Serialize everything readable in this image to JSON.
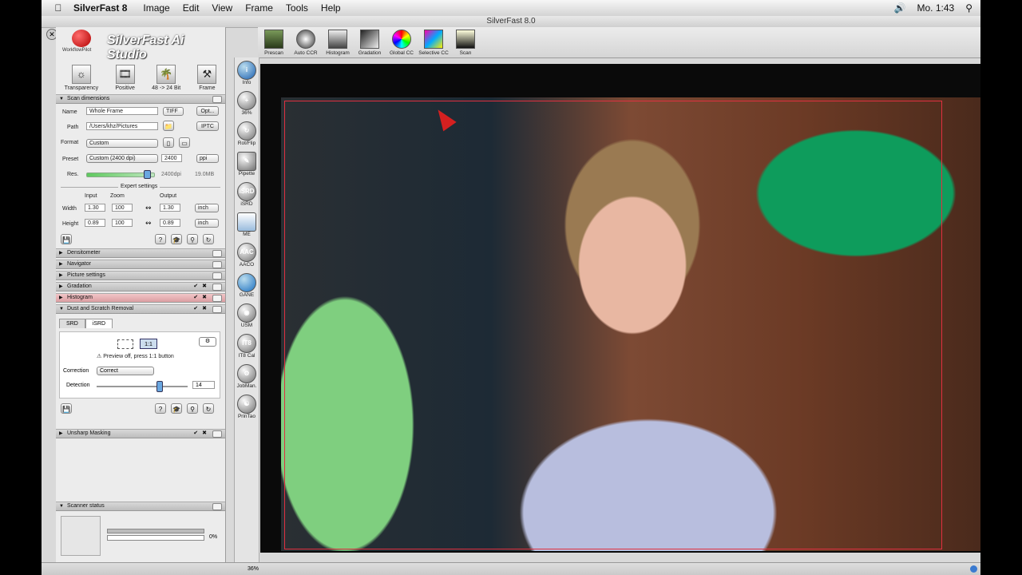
{
  "menubar": {
    "app_name": "SilverFast 8",
    "menus": [
      "Image",
      "Edit",
      "View",
      "Frame",
      "Tools",
      "Help"
    ],
    "clock": "Mo. 1:43"
  },
  "window": {
    "title": "SilverFast 8.0"
  },
  "left": {
    "workflow_label": "WorkflowPilot",
    "brand": "SilverFast Ai Studio",
    "top_icons": [
      {
        "label": "Transparency"
      },
      {
        "label": "Positive"
      },
      {
        "label": "48 -> 24 Bit"
      },
      {
        "label": "Frame"
      }
    ],
    "scan_dimensions": {
      "title": "Scan dimensions",
      "name_label": "Name",
      "name_value": "Whole Frame",
      "format_select": "TIFF",
      "opt_button": "Opt...",
      "path_label": "Path",
      "path_value": "/Users/khz/Pictures",
      "iptc_button": "IPTC",
      "format_label": "Format",
      "format_value": "Custom",
      "preset_label": "Preset",
      "preset_value": "Custom (2400 dpi)",
      "preset_dpi": "2400",
      "dpi_unit": "ppi",
      "res_label": "Res.",
      "res_value": "2400dpi",
      "file_size": "19.0MB",
      "expert_label": "Expert settings",
      "input_label": "Input",
      "zoom_label": "Zoom",
      "output_label": "Output",
      "width_label": "Width",
      "width_in": "1.30",
      "width_zoom": "100",
      "width_out": "1.30",
      "height_label": "Height",
      "height_in": "0.89",
      "height_zoom": "100",
      "height_out": "0.89",
      "unit": "inch"
    },
    "sections": {
      "densitometer": "Densitometer",
      "navigator": "Navigator",
      "picture_settings": "Picture settings",
      "gradation": "Gradation",
      "histogram": "Histogram",
      "dust": "Dust and Scratch Removal",
      "unsharp": "Unsharp Masking",
      "scanner_status": "Scanner status"
    },
    "dust_panel": {
      "tab1": "SRD",
      "tab2": "iSRD",
      "warning": "Preview off, press 1:1 button",
      "one_to_one": "1:1",
      "correction_label": "Correction",
      "correction_value": "Correct",
      "detection_label": "Detection",
      "detection_value": "14",
      "detection_level": 0.68
    },
    "scanner_status_percent": "0%"
  },
  "tools": [
    "Info",
    "36%",
    "Rot/Flip",
    "Pipette",
    "iSRD",
    "ME",
    "AACO",
    "GANE",
    "USM",
    "IT8 Cal",
    "JobMan.",
    "PrinTao"
  ],
  "top_tools": [
    "Prescan",
    "Auto CCR",
    "Histogram",
    "Gradation",
    "Global CC",
    "Selective CC",
    "Scan"
  ],
  "status": {
    "zoom": "36%"
  },
  "colors": {
    "histogram_highlight": "#dc9ea2",
    "crop_frame": "#e03040"
  }
}
